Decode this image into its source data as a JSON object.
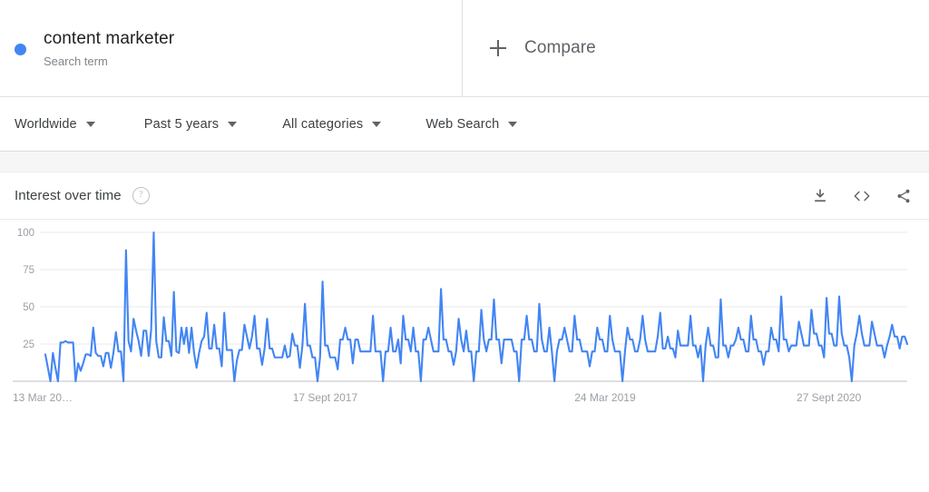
{
  "term": {
    "name": "content marketer",
    "subtitle": "Search term",
    "dot_color": "#4285f4"
  },
  "compare": {
    "label": "Compare",
    "icon": "plus-icon"
  },
  "filters": [
    {
      "label": "Worldwide",
      "name": "location"
    },
    {
      "label": "Past 5 years",
      "name": "time-range"
    },
    {
      "label": "All categories",
      "name": "category"
    },
    {
      "label": "Web Search",
      "name": "search-type"
    }
  ],
  "card": {
    "title": "Interest over time",
    "help_icon": "help-icon",
    "actions": [
      {
        "name": "download-icon",
        "label": "download"
      },
      {
        "name": "embed-icon",
        "label": "<>"
      },
      {
        "name": "share-icon",
        "label": "share"
      }
    ]
  },
  "chart_data": {
    "type": "line",
    "title": "Interest over time",
    "xlabel": "",
    "ylabel": "",
    "ylim": [
      0,
      100
    ],
    "yticks": [
      25,
      50,
      75,
      100
    ],
    "grid": true,
    "legend": false,
    "line_color": "#4285f4",
    "xtick_labels": [
      "13 Mar 20…",
      "17 Sept 2017",
      "24 Mar 2019",
      "27 Sept 2020"
    ],
    "xtick_positions": [
      0,
      0.3247,
      0.6494,
      0.9091
    ],
    "series": [
      {
        "name": "content marketer",
        "values": [
          18,
          9,
          0,
          19,
          9,
          0,
          26,
          26,
          27,
          26,
          26,
          26,
          0,
          12,
          7,
          12,
          18,
          18,
          17,
          36,
          19,
          17,
          17,
          10,
          19,
          19,
          9,
          19,
          33,
          20,
          20,
          0,
          88,
          27,
          20,
          42,
          34,
          27,
          17,
          34,
          34,
          17,
          35,
          100,
          27,
          16,
          16,
          43,
          27,
          27,
          17,
          60,
          20,
          19,
          36,
          25,
          36,
          19,
          36,
          19,
          9,
          19,
          27,
          30,
          46,
          22,
          22,
          38,
          22,
          22,
          10,
          46,
          21,
          21,
          21,
          0,
          14,
          21,
          21,
          38,
          30,
          22,
          30,
          44,
          22,
          22,
          11,
          22,
          42,
          22,
          22,
          16,
          16,
          16,
          16,
          24,
          16,
          17,
          32,
          24,
          24,
          9,
          24,
          52,
          24,
          24,
          16,
          16,
          0,
          16,
          67,
          24,
          24,
          16,
          16,
          16,
          8,
          28,
          28,
          36,
          28,
          28,
          12,
          28,
          28,
          20,
          20,
          20,
          20,
          20,
          44,
          20,
          20,
          20,
          0,
          20,
          20,
          36,
          20,
          20,
          28,
          12,
          44,
          28,
          28,
          20,
          36,
          20,
          20,
          0,
          28,
          28,
          36,
          28,
          20,
          20,
          20,
          62,
          28,
          28,
          20,
          20,
          11,
          20,
          42,
          28,
          20,
          34,
          20,
          20,
          0,
          20,
          20,
          48,
          28,
          20,
          28,
          28,
          55,
          28,
          28,
          12,
          28,
          28,
          28,
          28,
          20,
          20,
          0,
          28,
          28,
          44,
          28,
          28,
          20,
          20,
          52,
          28,
          20,
          20,
          36,
          20,
          0,
          20,
          28,
          28,
          36,
          28,
          20,
          20,
          44,
          28,
          28,
          20,
          20,
          20,
          10,
          20,
          20,
          36,
          28,
          28,
          20,
          20,
          44,
          28,
          20,
          20,
          20,
          0,
          20,
          36,
          28,
          28,
          20,
          20,
          28,
          44,
          28,
          20,
          20,
          20,
          20,
          30,
          46,
          22,
          22,
          30,
          22,
          22,
          16,
          34,
          24,
          24,
          24,
          24,
          44,
          24,
          24,
          16,
          24,
          0,
          24,
          36,
          24,
          24,
          16,
          16,
          55,
          24,
          24,
          16,
          24,
          24,
          28,
          36,
          28,
          28,
          20,
          20,
          44,
          28,
          28,
          20,
          20,
          11,
          20,
          20,
          36,
          28,
          28,
          20,
          57,
          28,
          28,
          20,
          24,
          24,
          24,
          40,
          32,
          24,
          24,
          24,
          48,
          32,
          32,
          24,
          24,
          16,
          56,
          32,
          32,
          24,
          24,
          57,
          32,
          24,
          24,
          16,
          0,
          24,
          32,
          44,
          32,
          24,
          24,
          24,
          40,
          32,
          24,
          24,
          24,
          16,
          24,
          30,
          38,
          30,
          30,
          22,
          30,
          30,
          25
        ]
      }
    ]
  }
}
